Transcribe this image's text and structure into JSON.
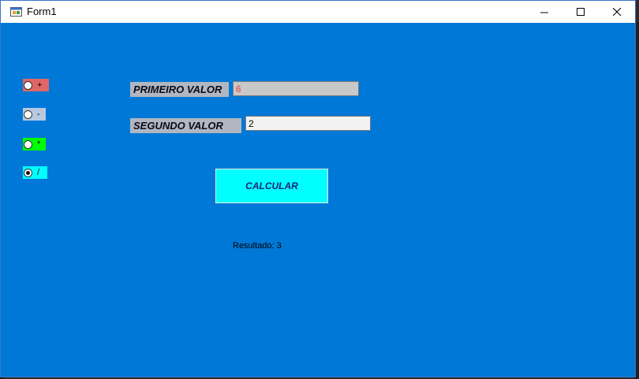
{
  "window": {
    "title": "Form1"
  },
  "operations": [
    {
      "label": "+",
      "color": "#e06666",
      "checked": false
    },
    {
      "label": "-",
      "color": "#b7c9e0",
      "checked": false
    },
    {
      "label": "*",
      "color": "#00ff00",
      "checked": false
    },
    {
      "label": "/",
      "color": "#00ffff",
      "checked": true
    }
  ],
  "fields": {
    "primeiro_label": "PRIMEIRO VALOR",
    "primeiro_value": "6",
    "segundo_label": "SEGUNDO VALOR",
    "segundo_value": "2"
  },
  "calcular_label": "CALCULAR",
  "resultado_text": "Resultado: 3",
  "colors": {
    "form_background": "#0078d7",
    "button_background": "#00ffff",
    "label_background": "#b0b7c0",
    "primeiro_text": "#e06666"
  }
}
